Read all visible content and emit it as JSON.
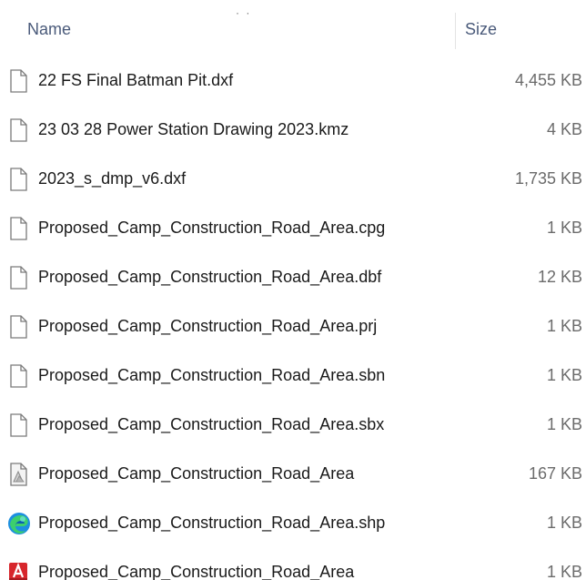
{
  "header": {
    "dots": "· ·",
    "name_label": "Name",
    "size_label": "Size"
  },
  "files": [
    {
      "name": "22 FS Final Batman Pit.dxf",
      "size": "4,455 KB",
      "icon": "blank-document-icon"
    },
    {
      "name": "23 03 28 Power Station Drawing 2023.kmz",
      "size": "4 KB",
      "icon": "blank-document-icon"
    },
    {
      "name": "2023_s_dmp_v6.dxf",
      "size": "1,735 KB",
      "icon": "blank-document-icon"
    },
    {
      "name": "Proposed_Camp_Construction_Road_Area.cpg",
      "size": "1 KB",
      "icon": "blank-document-icon"
    },
    {
      "name": "Proposed_Camp_Construction_Road_Area.dbf",
      "size": "12 KB",
      "icon": "blank-document-icon"
    },
    {
      "name": "Proposed_Camp_Construction_Road_Area.prj",
      "size": "1 KB",
      "icon": "blank-document-icon"
    },
    {
      "name": "Proposed_Camp_Construction_Road_Area.sbn",
      "size": "1 KB",
      "icon": "blank-document-icon"
    },
    {
      "name": "Proposed_Camp_Construction_Road_Area.sbx",
      "size": "1 KB",
      "icon": "blank-document-icon"
    },
    {
      "name": "Proposed_Camp_Construction_Road_Area",
      "size": "167 KB",
      "icon": "shapefile-document-icon"
    },
    {
      "name": "Proposed_Camp_Construction_Road_Area.shp",
      "size": "1 KB",
      "icon": "edge-browser-icon"
    },
    {
      "name": "Proposed_Camp_Construction_Road_Area",
      "size": "1 KB",
      "icon": "autocad-shx-icon"
    }
  ]
}
